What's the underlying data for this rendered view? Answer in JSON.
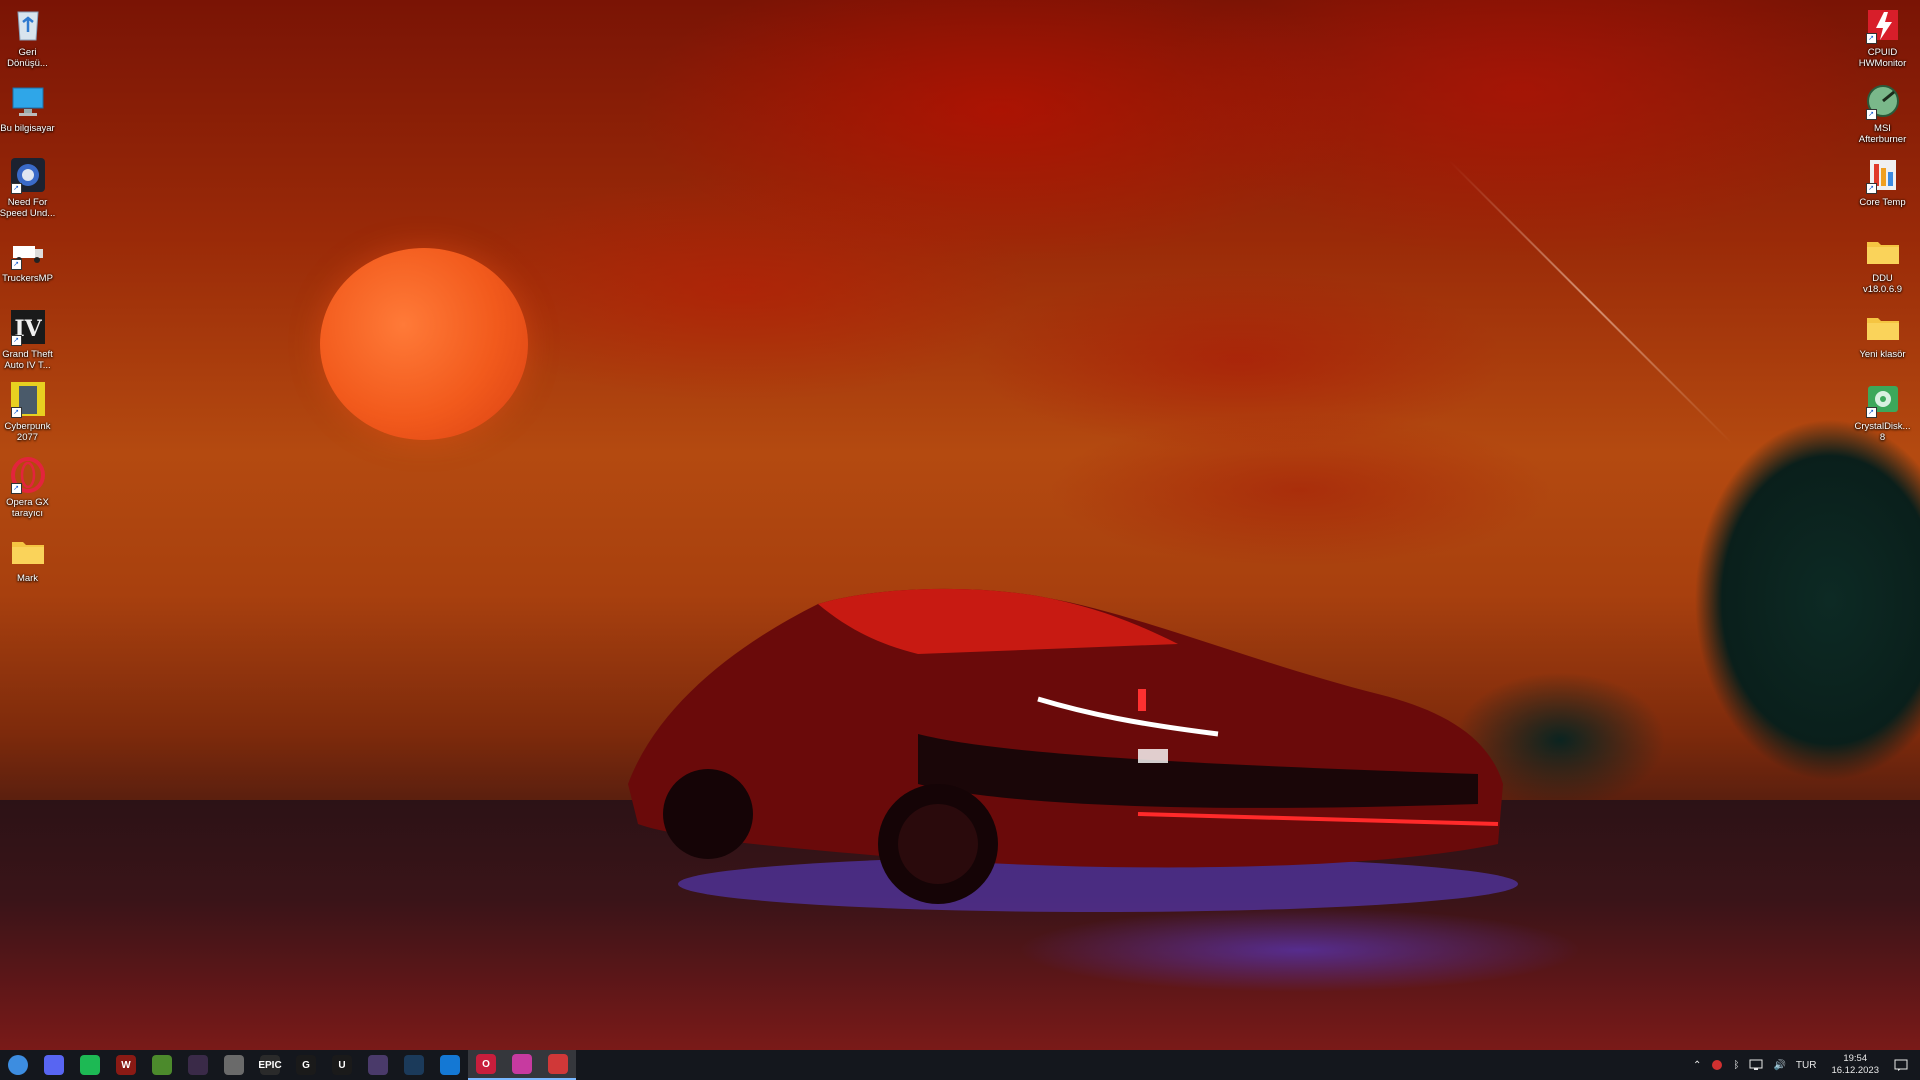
{
  "desktop": {
    "left_icons": [
      {
        "label": "Geri\nDönüşü...",
        "icon": "recycle-bin-icon"
      },
      {
        "label": "Bu bilgisayar",
        "icon": "this-pc-icon"
      },
      {
        "label": "Need For\nSpeed Und...",
        "icon": "need-for-speed-icon"
      },
      {
        "label": "TruckersMP",
        "icon": "truckersmp-icon"
      },
      {
        "label": "Grand Theft\nAuto IV T...",
        "icon": "gta-iv-icon"
      },
      {
        "label": "Cyberpunk\n2077",
        "icon": "cyberpunk-icon"
      },
      {
        "label": "Opera GX\ntarayıcı",
        "icon": "opera-gx-icon"
      },
      {
        "label": "Mark",
        "icon": "folder-icon"
      }
    ],
    "right_icons": [
      {
        "label": "CPUID\nHWMonitor",
        "icon": "hwmonitor-icon"
      },
      {
        "label": "MSI\nAfterburner",
        "icon": "msi-afterburner-icon"
      },
      {
        "label": "Core Temp",
        "icon": "core-temp-icon"
      },
      {
        "label": "DDU\nv18.0.6.9",
        "icon": "folder-icon"
      },
      {
        "label": "Yeni klasör",
        "icon": "folder-icon"
      },
      {
        "label": "CrystalDisk...\n8",
        "icon": "crystaldisk-icon"
      }
    ]
  },
  "taskbar": {
    "apps": [
      {
        "icon": "start-orb-icon",
        "glyph": "",
        "color": "#3d8de0"
      },
      {
        "icon": "discord-icon",
        "glyph": "",
        "color": "#5865f2"
      },
      {
        "icon": "spotify-icon",
        "glyph": "",
        "color": "#1db954"
      },
      {
        "icon": "witcher-icon",
        "glyph": "W",
        "color": "#8a1a14"
      },
      {
        "icon": "minecraft-launcher-icon",
        "glyph": "",
        "color": "#4c8a2c"
      },
      {
        "icon": "app-dark-icon",
        "glyph": "",
        "color": "#3a2a48"
      },
      {
        "icon": "app-gray-icon",
        "glyph": "",
        "color": "#6a6a6a"
      },
      {
        "icon": "epic-games-icon",
        "glyph": "EPIC",
        "color": "#2a2a2a"
      },
      {
        "icon": "logitech-icon",
        "glyph": "G",
        "color": "#1a1a1a"
      },
      {
        "icon": "ubisoft-icon",
        "glyph": "U",
        "color": "#1a1a1a"
      },
      {
        "icon": "app-console-icon",
        "glyph": "",
        "color": "#4a3a6a"
      },
      {
        "icon": "steam-icon",
        "glyph": "",
        "color": "#1b3a5a"
      },
      {
        "icon": "battlenet-icon",
        "glyph": "",
        "color": "#1478d4"
      },
      {
        "icon": "opera-gx-icon",
        "glyph": "O",
        "color": "#c81e3c"
      },
      {
        "icon": "screenshot-tool-icon",
        "glyph": "",
        "color": "#c73aa0"
      },
      {
        "icon": "snipping-tool-icon",
        "glyph": "",
        "color": "#d03838"
      }
    ],
    "active_index": [
      13,
      14,
      15
    ],
    "tray": {
      "language": "TUR",
      "time": "19:54",
      "date": "16.12.2023"
    }
  }
}
